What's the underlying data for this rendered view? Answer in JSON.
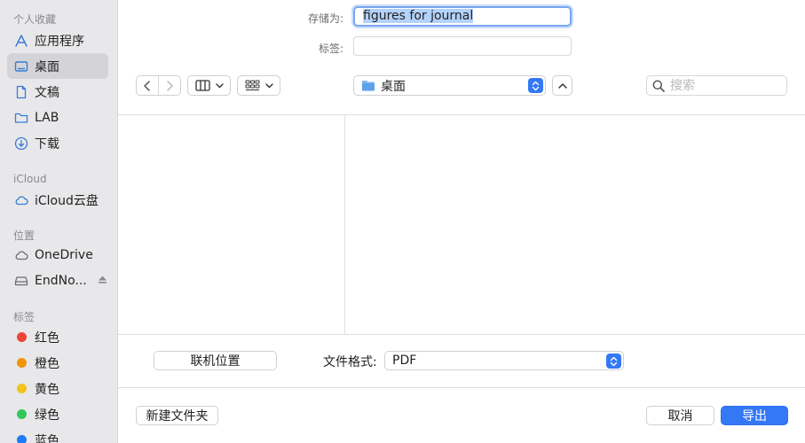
{
  "sidebar": {
    "favorites_title": "个人收藏",
    "favorites": [
      {
        "label": "应用程序",
        "icon": "applications-icon"
      },
      {
        "label": "桌面",
        "icon": "desktop-icon",
        "active": true
      },
      {
        "label": "文稿",
        "icon": "document-icon"
      },
      {
        "label": "LAB",
        "icon": "folder-icon"
      },
      {
        "label": "下载",
        "icon": "download-icon"
      }
    ],
    "icloud_title": "iCloud",
    "icloud": [
      {
        "label": "iCloud云盘",
        "icon": "cloud-icon"
      }
    ],
    "locations_title": "位置",
    "locations": [
      {
        "label": "OneDrive",
        "icon": "cloud-icon"
      },
      {
        "label": "EndNo...",
        "icon": "drive-icon",
        "ejectable": true
      }
    ],
    "tags_title": "标签",
    "tags": [
      {
        "label": "红色",
        "color": "#ee4539"
      },
      {
        "label": "橙色",
        "color": "#f2940b"
      },
      {
        "label": "黄色",
        "color": "#f2c319"
      },
      {
        "label": "绿色",
        "color": "#34c759"
      },
      {
        "label": "蓝色",
        "color": "#1e7cf5"
      }
    ]
  },
  "dialog": {
    "save_as_label": "存储为:",
    "save_as_value": "figures for journal",
    "tags_label": "标签:",
    "tags_value": "",
    "location": "桌面",
    "search_placeholder": "搜索",
    "network_button": "联机位置",
    "format_label": "文件格式:",
    "format_value": "PDF",
    "new_folder_button": "新建文件夹",
    "cancel_button": "取消",
    "export_button": "导出"
  },
  "colors": {
    "accent": "#3478f6",
    "sidebar_bg": "#e8e8ea",
    "sidebar_active": "#d4d4d8"
  }
}
